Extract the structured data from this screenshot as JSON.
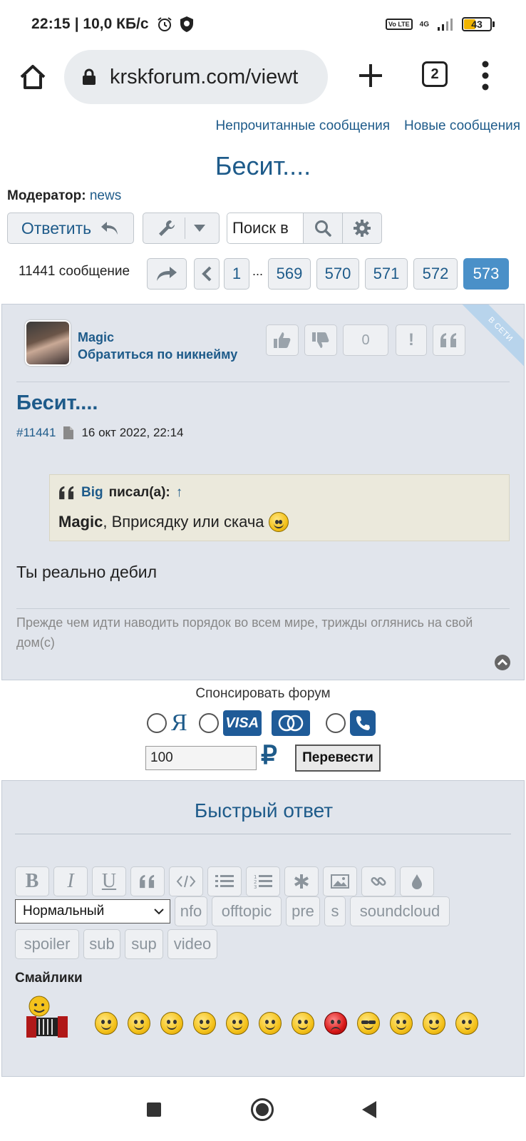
{
  "status_bar": {
    "time": "22:15",
    "speed": "| 10,0 КБ/с",
    "volte": "Vo LTE",
    "network": "4G",
    "battery": "43",
    "battery_level": 0.43
  },
  "browser": {
    "url": "krskforum.com/viewt",
    "tab_count": "2"
  },
  "header": {
    "unread_link": "Непрочитанные сообщения",
    "new_link": "Новые сообщения"
  },
  "topic": {
    "title": "Бесит....",
    "moderator_label": "Модератор:",
    "moderator_name": "news"
  },
  "toolbar": {
    "reply_label": "Ответить",
    "search_placeholder": "Поиск в"
  },
  "pagination": {
    "count_label": "11441 сообщение",
    "first": "1",
    "ellipsis": "...",
    "pages": [
      "569",
      "570",
      "571",
      "572"
    ],
    "current": "573"
  },
  "post": {
    "online_label": "В СЕТИ",
    "author": "Magic",
    "author_action": "Обратиться по никнейму",
    "rating": "0",
    "report_label": "!",
    "title": "Бесит....",
    "id": "#11441",
    "date": "16 окт 2022, 22:14",
    "quote": {
      "author": "Big",
      "wrote": "писал(а):",
      "arrow": "↑",
      "target": "Magic",
      "text": ", Вприсядку или скача"
    },
    "text": "Ты реально дебил",
    "signature": "Прежде чем идти наводить порядок во всем мире, трижды оглянись на свой дом(с)"
  },
  "sponsor": {
    "title": "Спонсировать форум",
    "yandex_label": "Я",
    "visa_label": "VISA",
    "amount": "100",
    "currency_symbol": "₽",
    "transfer_label": "Перевести"
  },
  "quick_reply": {
    "title": "Быстрый ответ",
    "bold": "B",
    "italic": "I",
    "underline": "U",
    "size_select": "Нормальный",
    "tags": [
      "nfo",
      "offtopic",
      "pre",
      "s",
      "soundcloud",
      "spoiler",
      "sub",
      "sup",
      "video"
    ],
    "smilies_label": "Смайлики"
  },
  "colors": {
    "link": "#1e5b8a",
    "active_page": "#4a90c8",
    "post_bg": "#e1e5ec",
    "quote_bg": "#ebe9dc"
  }
}
